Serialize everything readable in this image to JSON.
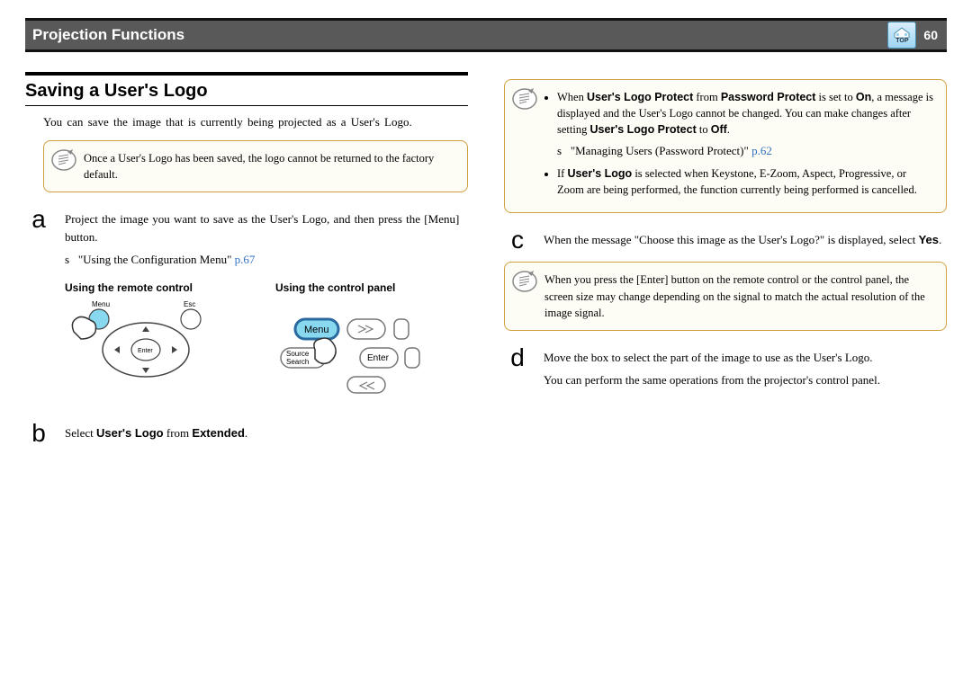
{
  "header": {
    "title": "Projection Functions",
    "top_label": "TOP",
    "page_number": "60"
  },
  "left": {
    "section_heading": "Saving a User's Logo",
    "intro": "You can save the image that is currently being projected as a User's Logo.",
    "note1": "Once a User's Logo has been saved, the logo cannot be returned to the factory default.",
    "step_a": {
      "letter": "a",
      "text": "Project the image you want to save as the User's Logo, and then press the [Menu] button.",
      "ref_prefix": "s",
      "ref_text": "\"Using the Configuration Menu\"",
      "ref_page": "p.67",
      "sub1": "Using the remote control",
      "sub2": "Using the control panel"
    },
    "step_b": {
      "letter": "b",
      "text_pre": "Select ",
      "text_bold1": "User's Logo",
      "text_mid": " from ",
      "text_bold2": "Extended",
      "text_post": "."
    },
    "illus_labels": {
      "menu": "Menu",
      "esc": "Esc",
      "enter": "Enter",
      "menu_btn": "Menu",
      "source_search": "Source\nSearch",
      "enter_btn": "Enter"
    }
  },
  "right": {
    "note1": {
      "bullet1_pre": "When ",
      "bullet1_b1": "User's Logo Protect",
      "bullet1_mid1": " from ",
      "bullet1_b2": "Password Protect",
      "bullet1_mid2": " is set to ",
      "bullet1_b3": "On",
      "bullet1_post": ", a message is displayed and the User's Logo cannot be changed. You can make changes after setting ",
      "bullet1_b4": "User's Logo Protect",
      "bullet1_end": " to ",
      "bullet1_b5": "Off",
      "bullet1_tail": ".",
      "ref_prefix": "s",
      "ref_text": "\"Managing Users (Password Protect)\"",
      "ref_page": "p.62",
      "bullet2_pre": "If ",
      "bullet2_b1": "User's Logo",
      "bullet2_post": " is selected when Keystone, E-Zoom, Aspect, Progressive, or Zoom are being performed, the function currently being performed is cancelled."
    },
    "step_c": {
      "letter": "c",
      "text_pre": "When the message \"Choose this image as the User's Logo?\" is displayed, select ",
      "text_bold": "Yes",
      "text_post": "."
    },
    "note2": "When you press the [Enter] button on the remote control or the control panel, the screen size may change depending on the signal to match the actual resolution of the image signal.",
    "step_d": {
      "letter": "d",
      "text1": "Move the box to select the part of the image to use as the User's Logo.",
      "text2": "You can perform the same operations from the projector's control panel."
    }
  }
}
